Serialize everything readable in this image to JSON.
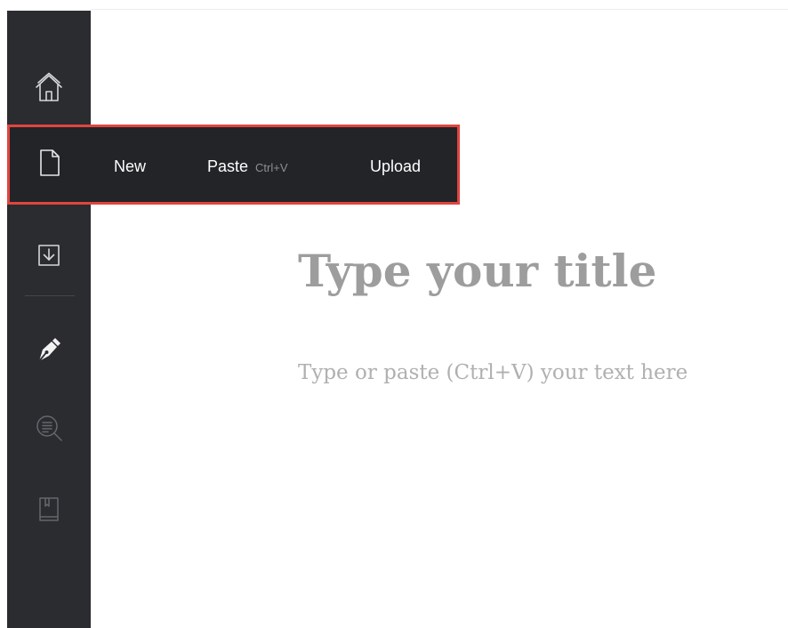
{
  "sidebar": {
    "items": [
      {
        "name": "home",
        "icon": "home-icon"
      },
      {
        "name": "new-document",
        "icon": "file-icon"
      },
      {
        "name": "download",
        "icon": "download-icon"
      },
      {
        "name": "write",
        "icon": "pen-nib-icon"
      },
      {
        "name": "review",
        "icon": "text-search-icon"
      },
      {
        "name": "library",
        "icon": "bookmark-book-icon"
      }
    ]
  },
  "new_menu": {
    "new_label": "New",
    "paste_label": "Paste",
    "paste_shortcut": "Ctrl+V",
    "upload_label": "Upload"
  },
  "editor": {
    "title_placeholder": "Type your title",
    "body_placeholder": "Type or paste (Ctrl+V) your text here"
  },
  "colors": {
    "sidebar_bg": "#2b2c30",
    "menu_bg": "#232428",
    "highlight_border": "#e0453f",
    "placeholder_text": "#9d9d9d"
  }
}
